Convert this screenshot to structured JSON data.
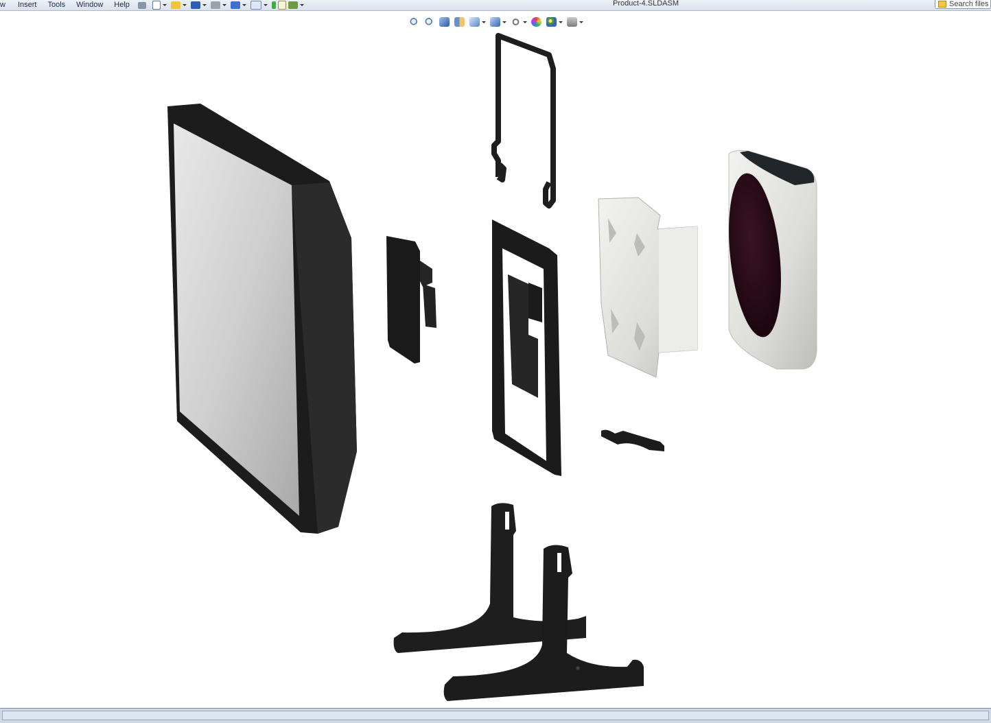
{
  "menu": {
    "items": [
      "w",
      "Insert",
      "Tools",
      "Window",
      "Help"
    ]
  },
  "window": {
    "document_title": "Product-4.SLDASM"
  },
  "search": {
    "placeholder": "Search files"
  },
  "toolbar": {
    "icons": [
      "new-icon",
      "open-icon",
      "save-icon",
      "print-icon",
      "undo-icon",
      "select-icon",
      "rebuild-icon",
      "file-properties-icon",
      "options-icon"
    ]
  },
  "view_toolbar": {
    "icons": [
      "zoom-to-fit-icon",
      "zoom-to-area-icon",
      "previous-view-icon",
      "section-view-icon",
      "view-orientation-icon",
      "display-style-icon",
      "hide-show-items-icon",
      "edit-appearance-icon",
      "apply-scene-icon",
      "view-settings-icon"
    ]
  },
  "colors": {
    "part_black": "#1f1f1f",
    "screen_grey": "#c9c9c9",
    "metal": "#e6e6e4",
    "disc": "#2a0a14"
  }
}
